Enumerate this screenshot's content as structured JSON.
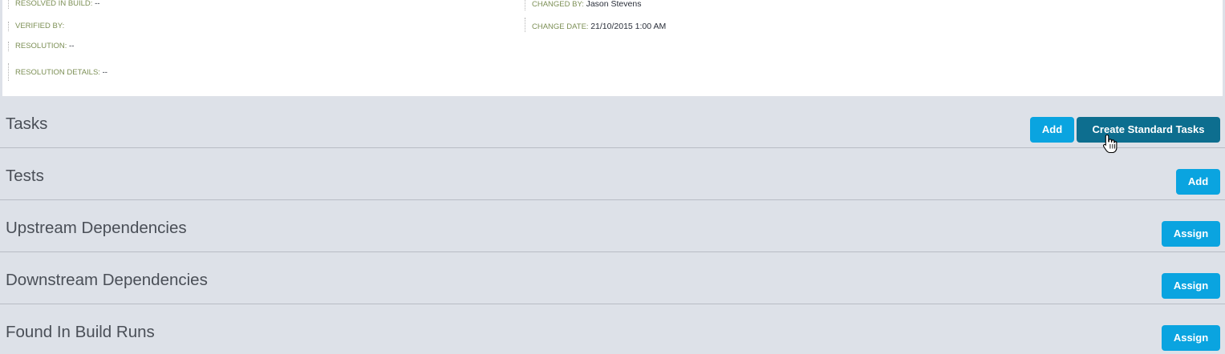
{
  "details": {
    "resolved_in_build": {
      "label": "RESOLVED IN BUILD:",
      "value": "--"
    },
    "verified_by": {
      "label": "VERIFIED BY:",
      "value": ""
    },
    "resolution": {
      "label": "RESOLUTION:",
      "value": "--"
    },
    "resolution_details": {
      "label": "RESOLUTION DETAILS:",
      "value": "--"
    },
    "changed_by": {
      "label": "CHANGED BY:",
      "value": "Jason Stevens"
    },
    "change_date": {
      "label": "CHANGE DATE:",
      "value": "21/10/2015 1:00 AM"
    }
  },
  "sections": {
    "tasks": {
      "title": "Tasks",
      "add_label": "Add",
      "create_label": "Create Standard Tasks"
    },
    "tests": {
      "title": "Tests",
      "add_label": "Add"
    },
    "upstream": {
      "title": "Upstream Dependencies",
      "assign_label": "Assign"
    },
    "downstream": {
      "title": "Downstream Dependencies",
      "assign_label": "Assign"
    },
    "found_in": {
      "title": "Found In Build Runs",
      "assign_label": "Assign"
    }
  },
  "colors": {
    "page_bg": "#dde1e8",
    "button_primary": "#0aa4e0",
    "button_hover": "#0d6e8f",
    "label_green": "#7c8f55"
  },
  "icons": {
    "cursor": "hand-pointer-icon"
  }
}
